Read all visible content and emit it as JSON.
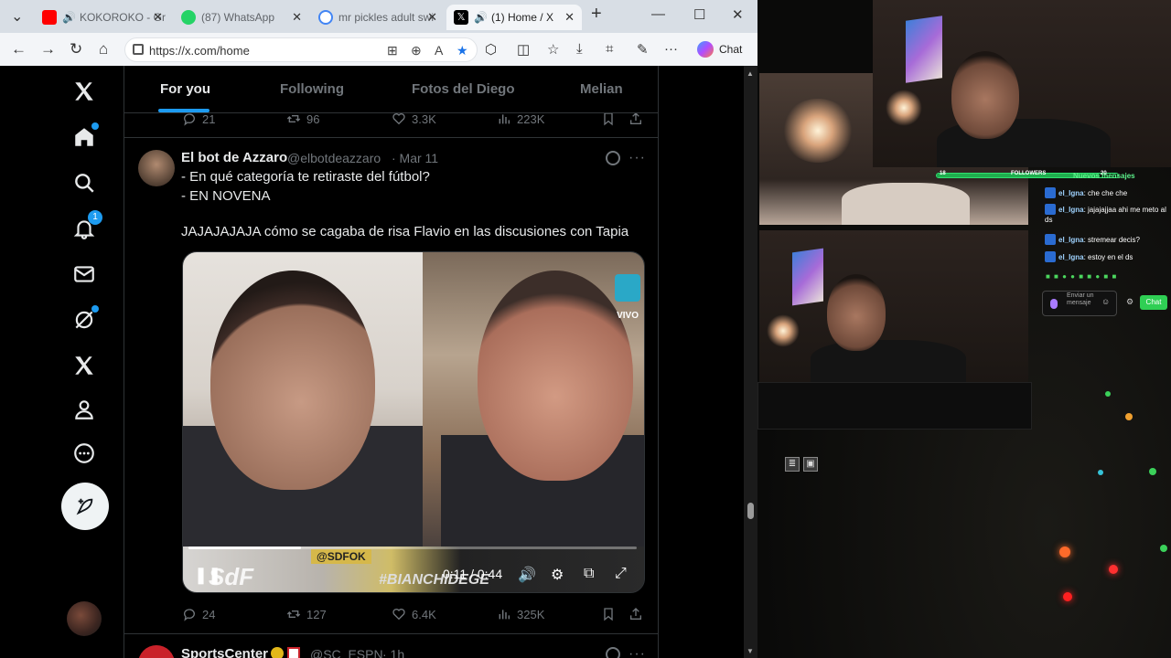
{
  "browser": {
    "tabs": [
      {
        "title": "KOKOROKO - Gr",
        "icon": "youtube-icon",
        "color": "#ff0000",
        "muted": true
      },
      {
        "title": "(87) WhatsApp",
        "icon": "whatsapp-icon",
        "color": "#25d366"
      },
      {
        "title": "mr pickles adult swi",
        "icon": "google-icon",
        "color": "#4285f4"
      },
      {
        "title": "(1) Home / X",
        "icon": "x-icon",
        "color": "#000000",
        "muted": true,
        "active": true
      }
    ],
    "new_tab": "+",
    "url": "https://x.com/home",
    "copilot_label": "Chat"
  },
  "x": {
    "feed_tabs": [
      "For you",
      "Following",
      "Fotos del Diego",
      "Melian"
    ],
    "active_tab": 0,
    "nav": {
      "notification_badge": "1"
    },
    "prev_actions": {
      "replies": "21",
      "reposts": "96",
      "likes": "3.3K",
      "views": "223K"
    },
    "tweet": {
      "name": "El bot de Azzaro",
      "handle": "@elbotdeazzaro",
      "time": "· Mar 11",
      "lines": [
        "- En qué categoría te retiraste del fútbol?",
        "- EN NOVENA",
        "JAJAJAJAJA cómo se cagaba de risa Flavio en las discusiones con Tapia"
      ],
      "video": {
        "time": "0:11 / 0:44",
        "progress": 0.25,
        "overlay_sdf": "SdF",
        "overlay_sdfok": "@SDFOK",
        "overlay_hashtag": "#BIANCHIDEGE",
        "overlay_vivo": "VIVO"
      },
      "actions": {
        "replies": "24",
        "reposts": "127",
        "likes": "6.4K",
        "views": "325K"
      }
    },
    "next_tweet": {
      "name": "SportsCenter",
      "handle": "@SC_ESPN",
      "time": "· 1h"
    }
  },
  "stream": {
    "followers_label": "FOLLOWERS",
    "followers_current": "18",
    "followers_goal": "20",
    "chat_header": "Nuevos mensajes",
    "messages": [
      {
        "user": "el_Igna",
        "text": "che che che"
      },
      {
        "user": "el_Igna",
        "text": "jajajajjaa ahi me meto al ds"
      },
      {
        "user": "el_Igna",
        "text": "stremear decis?"
      },
      {
        "user": "el_Igna",
        "text": "estoy en el ds"
      }
    ],
    "input_placeholder": "Enviar un mensaje",
    "send_label": "Chat"
  }
}
